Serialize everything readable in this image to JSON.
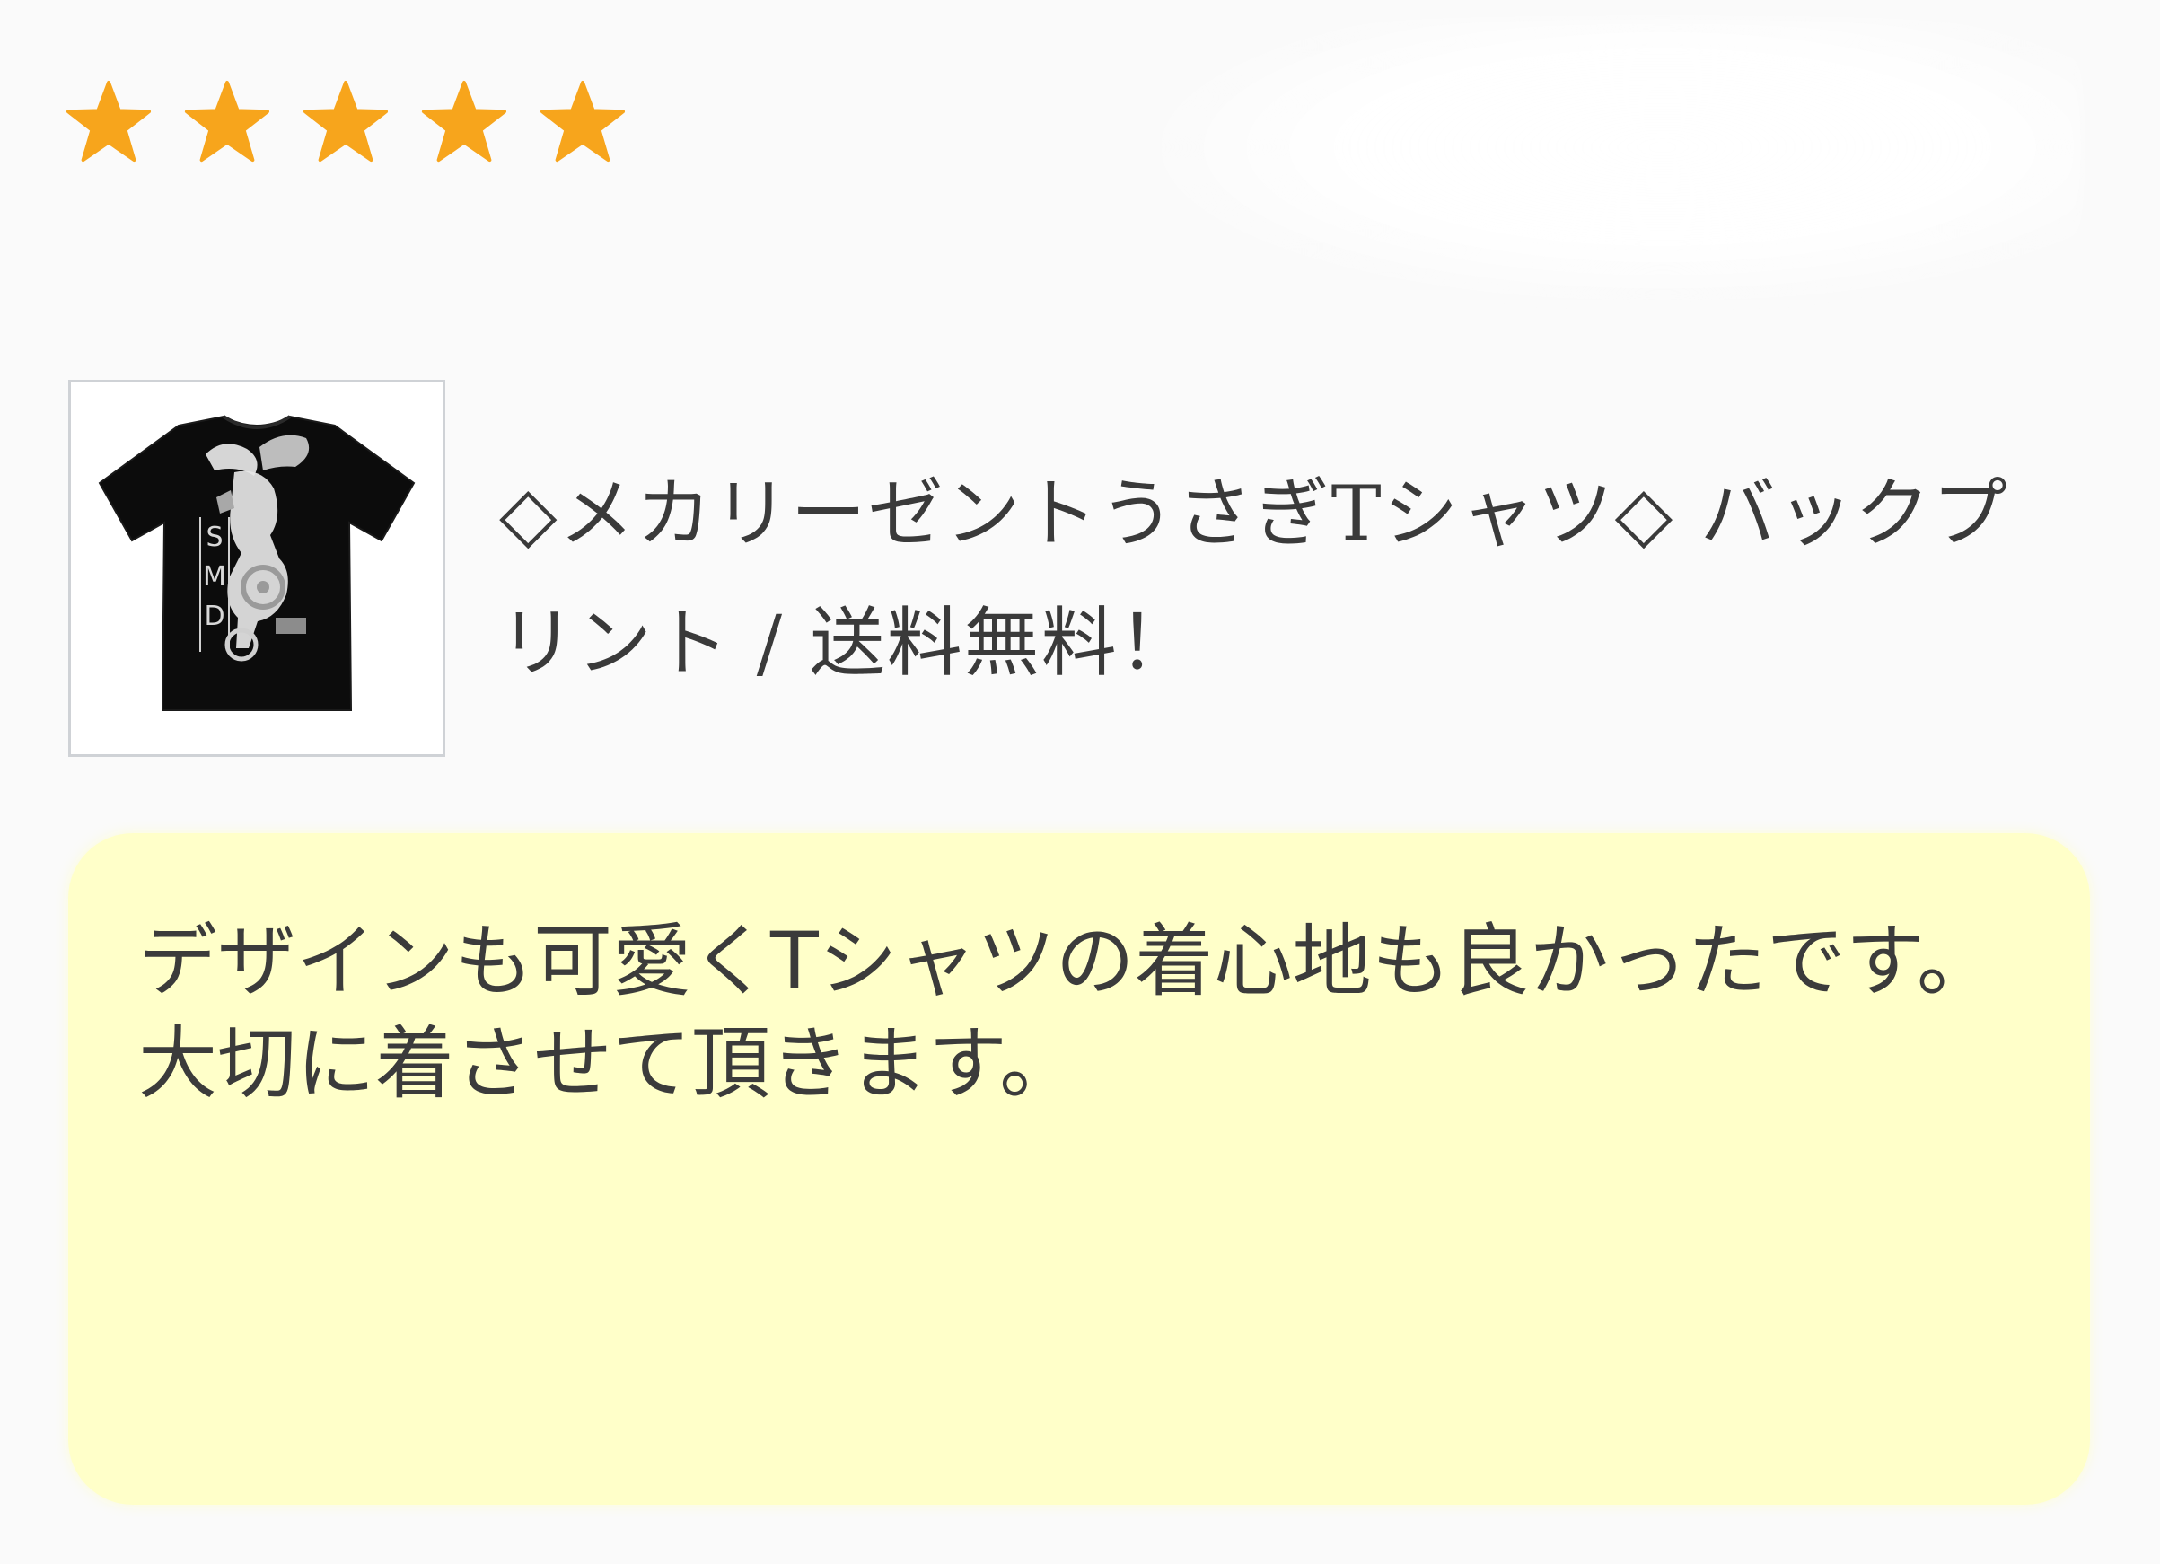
{
  "rating": {
    "value": 5,
    "max": 5,
    "star_color": "#f7a51c",
    "icon": "star-icon"
  },
  "product": {
    "image_alt": "black-tshirt-thumbnail",
    "title": "◇メカリーゼントうさぎTシャツ◇ バックプリント / 送料無料！",
    "print_letters": [
      "S",
      "M",
      "D"
    ]
  },
  "review": {
    "text": "デザインも可愛くTシャツの着心地も良かったです。\n大切に着させて頂きます。",
    "background": "#ffffc9"
  }
}
